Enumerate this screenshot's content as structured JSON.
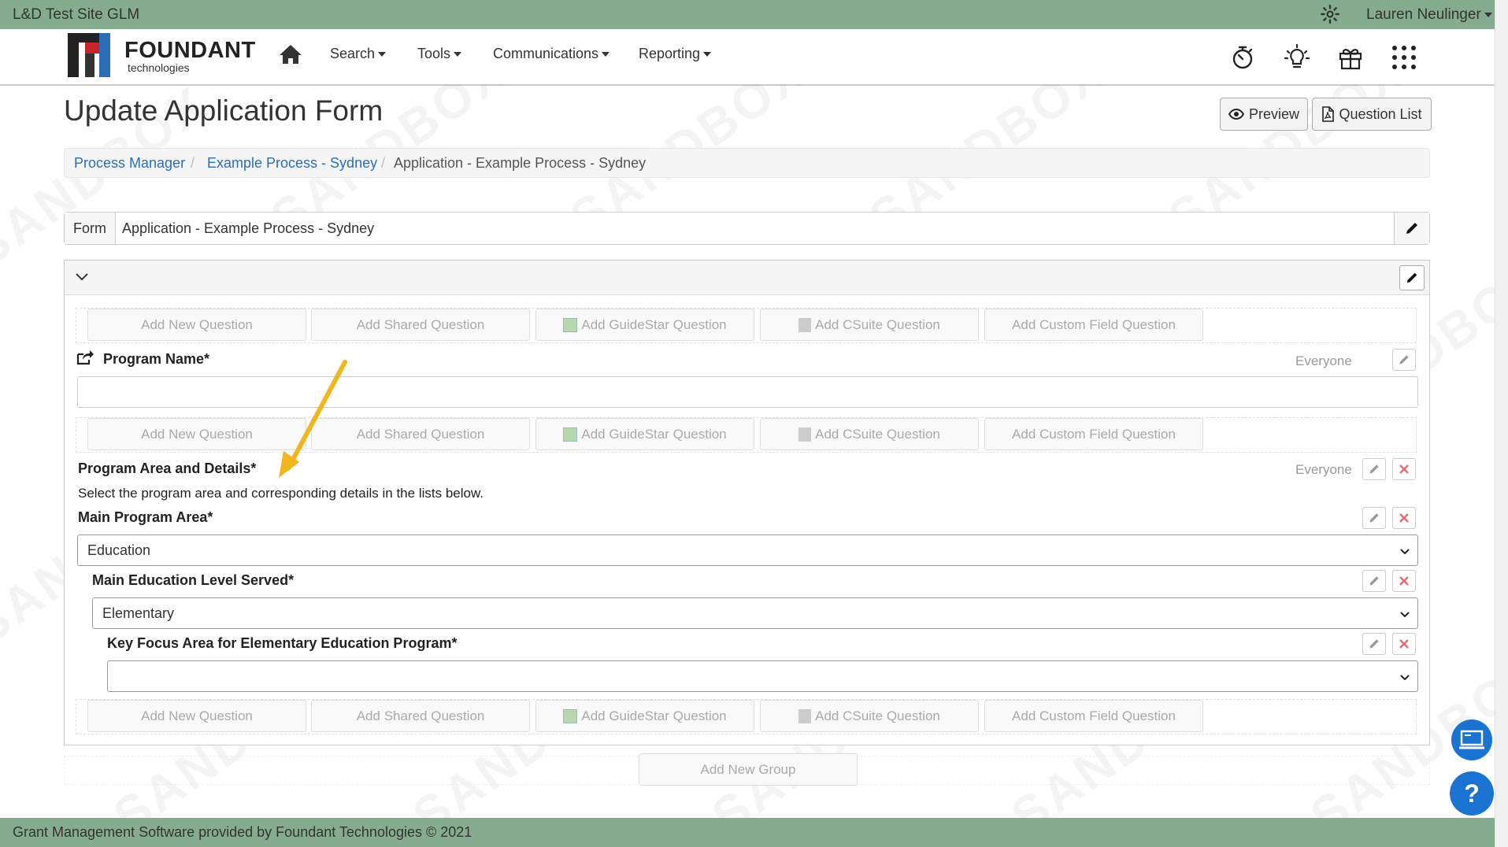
{
  "topbar": {
    "site_name": "L&D Test Site GLM",
    "user_name": "Lauren Neulinger"
  },
  "navbar": {
    "brand": "FOUNDANT",
    "brand_sub": "technologies",
    "menu": {
      "search": "Search",
      "tools": "Tools",
      "communications": "Communications",
      "reporting": "Reporting"
    }
  },
  "watermark": "SANDBOX",
  "page": {
    "title": "Update Application Form",
    "preview_label": "Preview",
    "question_list_label": "Question List"
  },
  "breadcrumb": {
    "process_manager": "Process Manager",
    "process": "Example Process - Sydney",
    "current": "Application - Example Process - Sydney",
    "separator": "/"
  },
  "form": {
    "label": "Form",
    "value": "Application - Example Process - Sydney"
  },
  "add_buttons": {
    "new_question": "Add New Question",
    "shared_question": "Add Shared Question",
    "guidestar_question": "Add GuideStar Question",
    "csuite_question": "Add CSuite Question",
    "custom_field_question": "Add Custom Field Question"
  },
  "questions": {
    "program_name": {
      "label": "Program Name*",
      "audience": "Everyone"
    },
    "program_area": {
      "label": "Program Area and Details*",
      "audience": "Everyone",
      "description": "Select the program area and corresponding details in the lists below."
    },
    "main_area": {
      "label": "Main Program Area*",
      "value": "Education"
    },
    "education_level": {
      "label": "Main Education Level Served*",
      "value": "Elementary"
    },
    "focus_area": {
      "label": "Key Focus Area for Elementary Education Program*",
      "value": ""
    }
  },
  "group": {
    "add_label": "Add New Group"
  },
  "footer": {
    "text": "Grant Management Software provided by Foundant Technologies © 2021"
  },
  "help": {
    "glyph": "?"
  },
  "colors": {
    "bar_green": "#86ac8f",
    "link_blue": "#2a6fb5",
    "arrow_yellow": "#f2b51b",
    "fab_blue": "#1a73d1",
    "delete_red": "#e07070"
  }
}
